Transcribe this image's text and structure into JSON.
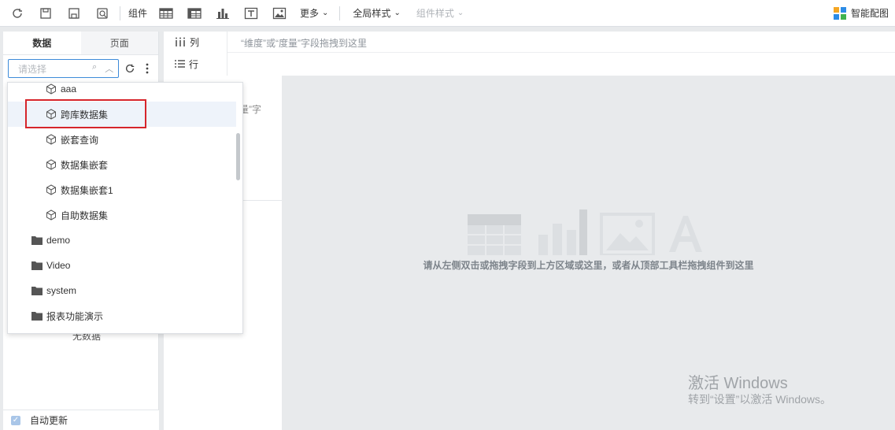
{
  "toolbar": {
    "component_label": "组件",
    "more_label": "更多",
    "global_style_label": "全局样式",
    "component_style_label": "组件样式",
    "smart_chart_label": "智能配图"
  },
  "left_panel": {
    "tabs": [
      {
        "label": "数据",
        "active": true
      },
      {
        "label": "页面",
        "active": false
      }
    ],
    "search_placeholder": "请选择",
    "no_data": "无数据",
    "auto_update_label": "自动更新"
  },
  "dropdown": {
    "items": [
      {
        "label": "aaa",
        "type": "dataset"
      },
      {
        "label": "跨库数据集",
        "type": "dataset"
      },
      {
        "label": "嵌套查询",
        "type": "dataset"
      },
      {
        "label": "数据集嵌套",
        "type": "dataset"
      },
      {
        "label": "数据集嵌套1",
        "type": "dataset"
      },
      {
        "label": "自助数据集",
        "type": "dataset"
      },
      {
        "label": "demo",
        "type": "folder"
      },
      {
        "label": "Video",
        "type": "folder"
      },
      {
        "label": "system",
        "type": "folder"
      },
      {
        "label": "报表功能演示",
        "type": "folder"
      }
    ]
  },
  "middle_panel": {
    "column_label": "列",
    "row_label": "行",
    "hint_fragment": "量”字"
  },
  "drop_area": {
    "hint": "“维度”或“度量”字段拖拽到这里"
  },
  "canvas": {
    "message": "请从左侧双击或拖拽字段到上方区域或这里，或者从顶部工具栏拖拽组件到这里"
  },
  "watermark": {
    "title": "激活 Windows",
    "subtitle": "转到“设置”以激活 Windows。"
  },
  "colors": {
    "accent": "#3d8bd9",
    "highlight": "#d6252b"
  }
}
